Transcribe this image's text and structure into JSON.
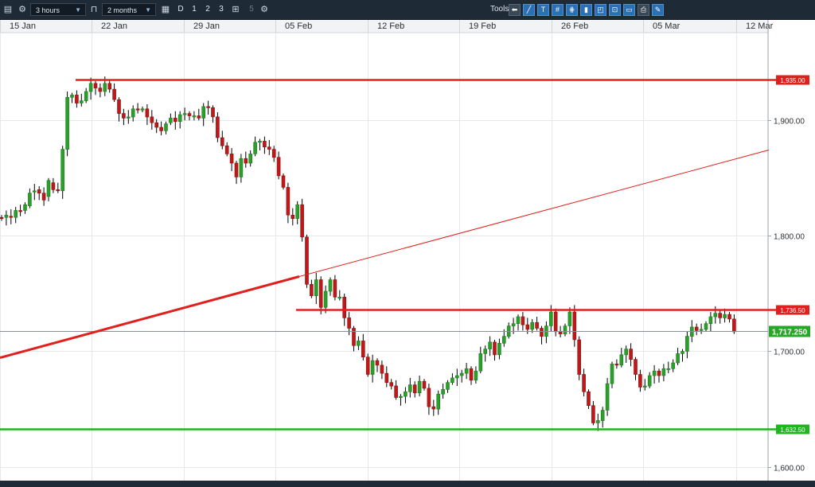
{
  "toolbar": {
    "interval": "3 hours",
    "range": "2 months",
    "periods": [
      "D",
      "1",
      "2",
      "3"
    ],
    "grey_period": "5",
    "tools_label": "Tools"
  },
  "chart_data": {
    "type": "candlestick",
    "date_labels": [
      "15 Jan",
      "22 Jan",
      "29 Jan",
      "05 Feb",
      "12 Feb",
      "19 Feb",
      "26 Feb",
      "05 Mar",
      "12 Mar"
    ],
    "y_ticks": [
      1600,
      1700,
      1800,
      1900
    ],
    "y_tick_labels": [
      "1,600.00",
      "1,700.00",
      "1,800.00",
      "1,900.00"
    ],
    "ylim": [
      1588,
      1976
    ],
    "current_price_label": "1,717.250",
    "current_price": 1717.25,
    "hlines": [
      {
        "value": 1935.0,
        "label": "1,935.00",
        "color": "#e0201c"
      },
      {
        "value": 1736.5,
        "label": "1,736.50",
        "color": "#e0201c"
      },
      {
        "value": 1632.5,
        "label": "1,632.50",
        "color": "#22b322"
      }
    ],
    "close": [
      1815,
      1818,
      1816,
      1822,
      1821,
      1827,
      1837,
      1839,
      1837,
      1831,
      1848,
      1840,
      1839,
      1875,
      1920,
      1922,
      1915,
      1917,
      1925,
      1932,
      1928,
      1925,
      1932,
      1927,
      1918,
      1906,
      1902,
      1903,
      1910,
      1909,
      1910,
      1903,
      1898,
      1894,
      1891,
      1897,
      1902,
      1899,
      1905,
      1906,
      1904,
      1904,
      1902,
      1912,
      1911,
      1903,
      1885,
      1878,
      1871,
      1863,
      1851,
      1867,
      1863,
      1871,
      1881,
      1882,
      1877,
      1875,
      1868,
      1852,
      1842,
      1818,
      1815,
      1827,
      1799,
      1758,
      1748,
      1762,
      1738,
      1752,
      1762,
      1747,
      1747,
      1729,
      1720,
      1705,
      1709,
      1695,
      1680,
      1692,
      1688,
      1681,
      1673,
      1670,
      1660,
      1661,
      1665,
      1671,
      1664,
      1674,
      1668,
      1652,
      1650,
      1663,
      1667,
      1673,
      1677,
      1679,
      1681,
      1685,
      1675,
      1683,
      1698,
      1702,
      1708,
      1697,
      1707,
      1713,
      1722,
      1724,
      1730,
      1723,
      1719,
      1725,
      1720,
      1713,
      1722,
      1734,
      1717,
      1715,
      1722,
      1734,
      1710,
      1680,
      1665,
      1653,
      1638,
      1640,
      1649,
      1672,
      1689,
      1688,
      1697,
      1702,
      1693,
      1680,
      1669,
      1670,
      1679,
      1683,
      1679,
      1685,
      1685,
      1690,
      1698,
      1700,
      1713,
      1721,
      1718,
      1719,
      1724,
      1730,
      1733,
      1729,
      1732,
      1728,
      1717
    ],
    "open_gap": [
      1,
      -2,
      1,
      -6,
      1,
      -5,
      -11,
      -1,
      3,
      6,
      -14,
      6,
      1,
      -36,
      -45,
      -2,
      7,
      -2,
      -8,
      -7,
      4,
      3,
      -7,
      5,
      9,
      12,
      4,
      -1,
      -7,
      1,
      -1,
      7,
      5,
      4,
      3,
      -6,
      -4,
      3,
      -6,
      -1,
      2,
      -1,
      2,
      -10,
      1,
      8,
      18,
      7,
      7,
      8,
      12,
      -16,
      4,
      -8,
      -10,
      -1,
      5,
      2,
      7,
      16,
      10,
      24,
      3,
      -12,
      28,
      41,
      10,
      -14,
      24,
      -14,
      -10,
      15,
      -1,
      18,
      9,
      15,
      -4,
      14,
      15,
      -12,
      4,
      7,
      8,
      3,
      10,
      -1,
      -4,
      -6,
      7,
      -10,
      6,
      16,
      2,
      -13,
      -4,
      -6,
      -4,
      -2,
      -2,
      -4,
      10,
      -8,
      -15,
      -4,
      -6,
      11,
      -10,
      -6,
      -9,
      -2,
      -6,
      7,
      4,
      -6,
      5,
      7,
      -9,
      -12,
      17,
      2,
      -7,
      -12,
      24,
      30,
      15,
      12,
      15,
      -2,
      -9,
      -23,
      -17,
      1,
      -9,
      -5,
      9,
      13,
      11,
      -1,
      -9,
      -4,
      4,
      -6,
      0,
      -5,
      -8,
      -2,
      -13,
      -8,
      3,
      -1,
      -5,
      -6,
      -3,
      4,
      -3,
      4,
      11
    ]
  }
}
